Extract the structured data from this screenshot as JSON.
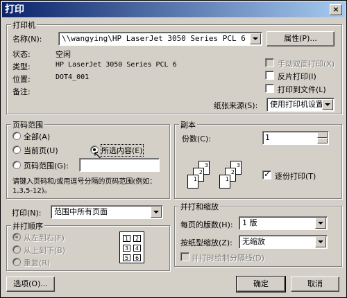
{
  "dialog": {
    "title": "打印",
    "close_glyph": "×"
  },
  "printer": {
    "legend": "打印机",
    "name_label": "名称(N):",
    "name_value": "\\\\wangying\\HP LaserJet 3050 Series PCL 6",
    "properties_button": "属性(P)...",
    "status_label": "状态:",
    "status_value": "空闲",
    "type_label": "类型:",
    "type_value": "HP LaserJet 3050 Series PCL 6",
    "location_label": "位置:",
    "location_value": "DOT4_001",
    "comment_label": "备注:",
    "manual_duplex": "手动双面打印(X)",
    "reverse_print": "反片打印(I)",
    "print_to_file": "打印到文件(L)",
    "paper_source_label": "纸张来源(S):",
    "paper_source_value": "使用打印机设置"
  },
  "page_range": {
    "legend": "页码范围",
    "all": "全部(A)",
    "current_page": "当前页(U)",
    "selection": "所选内容(E)",
    "pages": "页码范围(G):",
    "pages_value": "",
    "hint": "请键入页码和/或用逗号分隔的页码范围(例如：1,3,5-12)。"
  },
  "copies": {
    "legend": "副本",
    "count_label": "份数(C):",
    "count_value": "1",
    "collate": "逐份打印(T)"
  },
  "print_what": {
    "label": "打印(N):",
    "value": "范围中所有页面"
  },
  "order": {
    "legend": "并打顺序",
    "left_to_right": "从左到右(F)",
    "top_to_bottom": "从上到下(B)",
    "repeat": "重复(R)",
    "grid": [
      "1",
      "2",
      "3",
      "4",
      "5",
      "6"
    ]
  },
  "zoom": {
    "legend": "并打和缩放",
    "pages_per_sheet_label": "每页的版数(H):",
    "pages_per_sheet_value": "1 版",
    "scale_label": "按纸型缩放(Z):",
    "scale_value": "无缩放",
    "draw_borders": "并打时绘制分隔线(D)"
  },
  "buttons": {
    "options": "选项(O)...",
    "ok": "确定",
    "cancel": "取消"
  },
  "collate_pages": [
    "1",
    "2",
    "3"
  ]
}
